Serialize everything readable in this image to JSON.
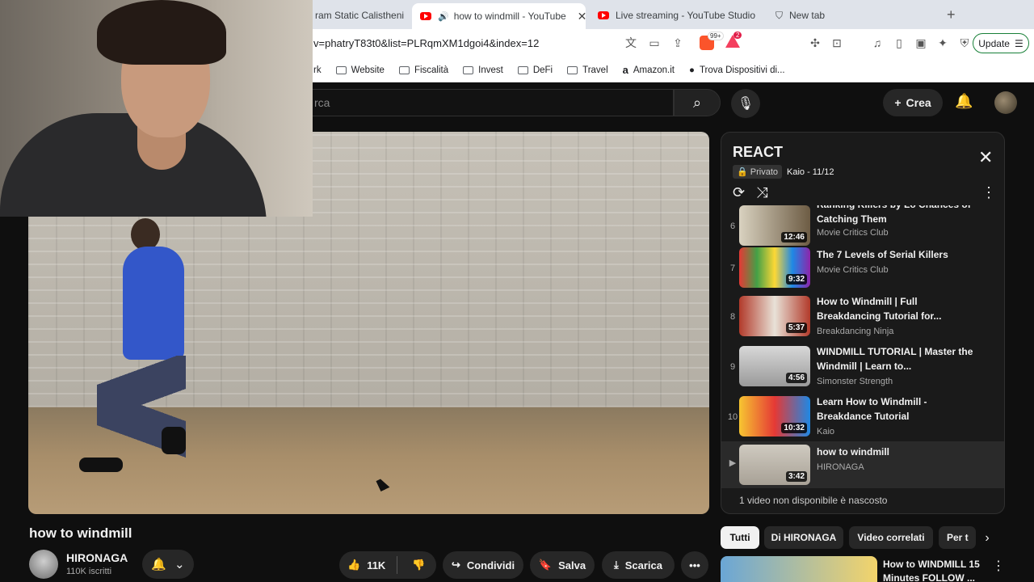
{
  "browser": {
    "tabs": [
      {
        "label": "ram Static Calisthenic",
        "active": false
      },
      {
        "label": "how to windmill - YouTube",
        "active": true,
        "speaker": "🔊"
      },
      {
        "label": "Live streaming - YouTube Studio",
        "active": false
      },
      {
        "label": "New tab",
        "active": false
      }
    ],
    "url": "v=phatryT83t0&list=PLRqmXM1dgoi4&index=12",
    "brave_badge": "99+",
    "warn_badge": "2",
    "update_label": "Update",
    "bookmarks": [
      "rk",
      "Website",
      "Fiscalità",
      "Invest",
      "DeFi",
      "Travel",
      "Amazon.it",
      "Trova Dispositivi di..."
    ]
  },
  "header": {
    "search_placeholder": "rca",
    "create_label": "Crea"
  },
  "video": {
    "title": "how to windmill",
    "channel": "HIRONAGA",
    "subscribers": "110K iscritti",
    "likes": "11K",
    "share_label": "Condividi",
    "save_label": "Salva",
    "download_label": "Scarica"
  },
  "playlist": {
    "title": "REACT",
    "privacy": "Privato",
    "owner_progress": "Kaio - 11/12",
    "items": [
      {
        "index": "6",
        "title": "Ranking Killers by Lo Chances of Catching Them",
        "channel": "Movie Critics Club",
        "duration": "12:46"
      },
      {
        "index": "7",
        "title": "The 7 Levels of Serial Killers",
        "channel": "Movie Critics Club",
        "duration": "9:32"
      },
      {
        "index": "8",
        "title": "How to Windmill | Full Breakdancing Tutorial for...",
        "channel": "Breakdancing Ninja",
        "duration": "5:37"
      },
      {
        "index": "9",
        "title": "WINDMILL TUTORIAL | Master the Windmill | Learn to...",
        "channel": "Simonster Strength",
        "duration": "4:56"
      },
      {
        "index": "10",
        "title": "Learn How to Windmill - Breakdance Tutorial",
        "channel": "Kaio",
        "duration": "10:32"
      },
      {
        "index": "▶",
        "title": "how to windmill",
        "channel": "HIRONAGA",
        "duration": "3:42"
      }
    ],
    "hidden_note": "1 video non disponibile è nascosto"
  },
  "chips": [
    "Tutti",
    "Di HIRONAGA",
    "Video correlati",
    "Per t"
  ],
  "recommended": {
    "title": "How to WINDMILL 15 Minutes FOLLOW ..."
  }
}
